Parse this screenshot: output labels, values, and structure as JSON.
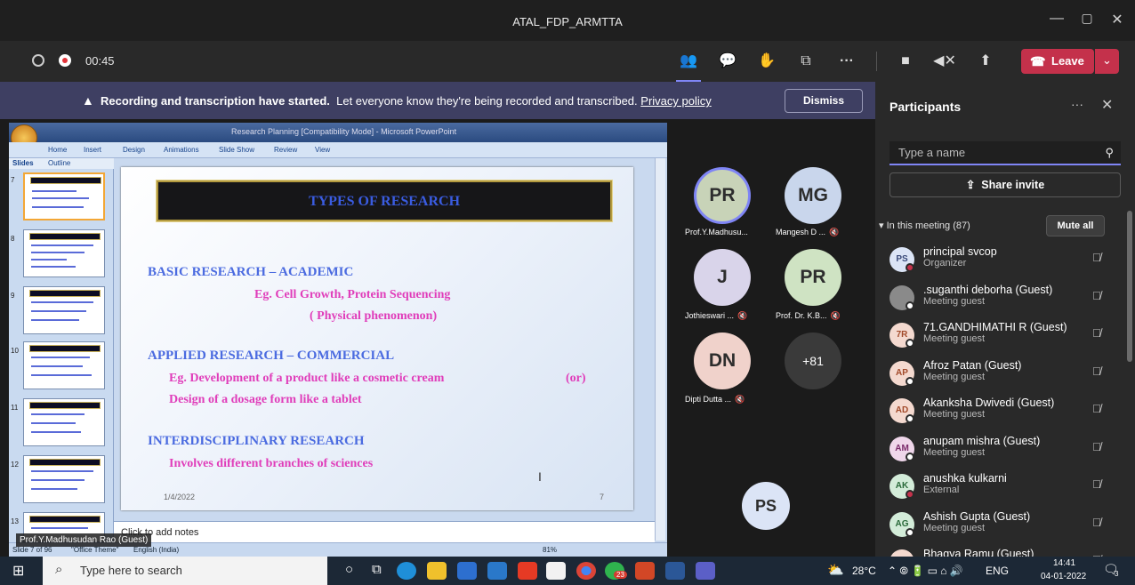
{
  "window": {
    "title": "ATAL_FDP_ARMTTA"
  },
  "call": {
    "timer": "00:45",
    "leave_label": "Leave"
  },
  "banner": {
    "bold": "Recording and transcription have started.",
    "text": "Let everyone know they're being recorded and transcribed.",
    "link": "Privacy policy",
    "dismiss": "Dismiss"
  },
  "ppt": {
    "window_title": "Research Planning [Compatibility Mode] - Microsoft PowerPoint",
    "tabs": [
      "Home",
      "Insert",
      "Design",
      "Animations",
      "Slide Show",
      "Review",
      "View"
    ],
    "pane_tabs": [
      "Slides",
      "Outline"
    ],
    "thumb_numbers": [
      "7",
      "8",
      "9",
      "10",
      "11",
      "12",
      "13"
    ],
    "notes": "Click to add notes",
    "status_slide": "Slide 7 of 96",
    "status_theme": "\"Office Theme\"",
    "status_lang": "English (India)",
    "zoom": "81%",
    "slide": {
      "title": "TYPES OF RESEARCH",
      "h1": "BASIC RESEARCH – ACADEMIC",
      "s1a": "Eg. Cell Growth, Protein Sequencing",
      "s1b": "( Physical phenomenon)",
      "h2": "APPLIED RESEARCH – COMMERCIAL",
      "s2a": "Eg. Development of a product like a cosmetic cream",
      "s2or": "(or)",
      "s2b": "Design of a dosage form like a tablet",
      "h3": "INTERDISCIPLINARY RESEARCH",
      "s3": "Involves different branches of sciences",
      "date": "1/4/2022",
      "page": "7"
    }
  },
  "presenter_tag": "Prof.Y.Madhusudan Rao (Guest)",
  "tiles": [
    {
      "initials": "PR",
      "name": "Prof.Y.Madhusu...",
      "bg": "#c8d3b8",
      "muted": false
    },
    {
      "initials": "MG",
      "name": "Mangesh D ...",
      "bg": "#c9d6ec",
      "muted": true
    },
    {
      "initials": "J",
      "name": "Jothieswari ...",
      "bg": "#d9d4ea",
      "muted": true
    },
    {
      "initials": "PR",
      "name": "Prof. Dr. K.B...",
      "bg": "#cfe3c3",
      "muted": true
    },
    {
      "initials": "DN",
      "name": "Dipti Dutta ...",
      "bg": "#f0d2cb",
      "muted": true
    },
    {
      "initials": "+81",
      "name": "",
      "bg": "#3a3a3a",
      "muted": false
    }
  ],
  "self_tile": {
    "initials": "PS"
  },
  "participants_panel": {
    "title": "Participants",
    "search_placeholder": "Type a name",
    "share_invite": "Share invite",
    "in_meeting": "In this meeting (87)",
    "mute_all": "Mute all",
    "people": [
      {
        "initials": "PS",
        "name": "principal svcop",
        "role": "Organizer",
        "bg": "#dbe4f6",
        "fg": "#3a4a7a",
        "badge": "#c4314b"
      },
      {
        "initials": "",
        "name": ".suganthi deborha (Guest)",
        "role": "Meeting guest",
        "bg": "#8a8a8a",
        "fg": "#fff",
        "badge": "#fff"
      },
      {
        "initials": "7R",
        "name": "71.GANDHIMATHI R (Guest)",
        "role": "Meeting guest",
        "bg": "#f4d9cf",
        "fg": "#a24a2a",
        "badge": "#fff"
      },
      {
        "initials": "AP",
        "name": "Afroz Patan (Guest)",
        "role": "Meeting guest",
        "bg": "#f4d9cf",
        "fg": "#a24a2a",
        "badge": "#fff"
      },
      {
        "initials": "AD",
        "name": "Akanksha Dwivedi (Guest)",
        "role": "Meeting guest",
        "bg": "#f4d9cf",
        "fg": "#a24a2a",
        "badge": "#fff"
      },
      {
        "initials": "AM",
        "name": "anupam mishra (Guest)",
        "role": "Meeting guest",
        "bg": "#efd6ea",
        "fg": "#7a2a6a",
        "badge": "#fff"
      },
      {
        "initials": "AK",
        "name": "anushka kulkarni",
        "role": "External",
        "bg": "#d3ecd9",
        "fg": "#2a6a3a",
        "badge": "#c4314b"
      },
      {
        "initials": "AG",
        "name": "Ashish Gupta (Guest)",
        "role": "Meeting guest",
        "bg": "#d3ecd9",
        "fg": "#2a6a3a",
        "badge": "#fff"
      },
      {
        "initials": "BR",
        "name": "Bhagya Ramu (Guest)",
        "role": "",
        "bg": "#f4d9cf",
        "fg": "#a24a2a",
        "badge": "#fff"
      }
    ]
  },
  "taskbar": {
    "search_placeholder": "Type here to search",
    "weather": "28°C",
    "lang": "ENG",
    "time": "14:41",
    "date": "04-01-2022",
    "notif": "3",
    "chrome_badge": "23"
  }
}
